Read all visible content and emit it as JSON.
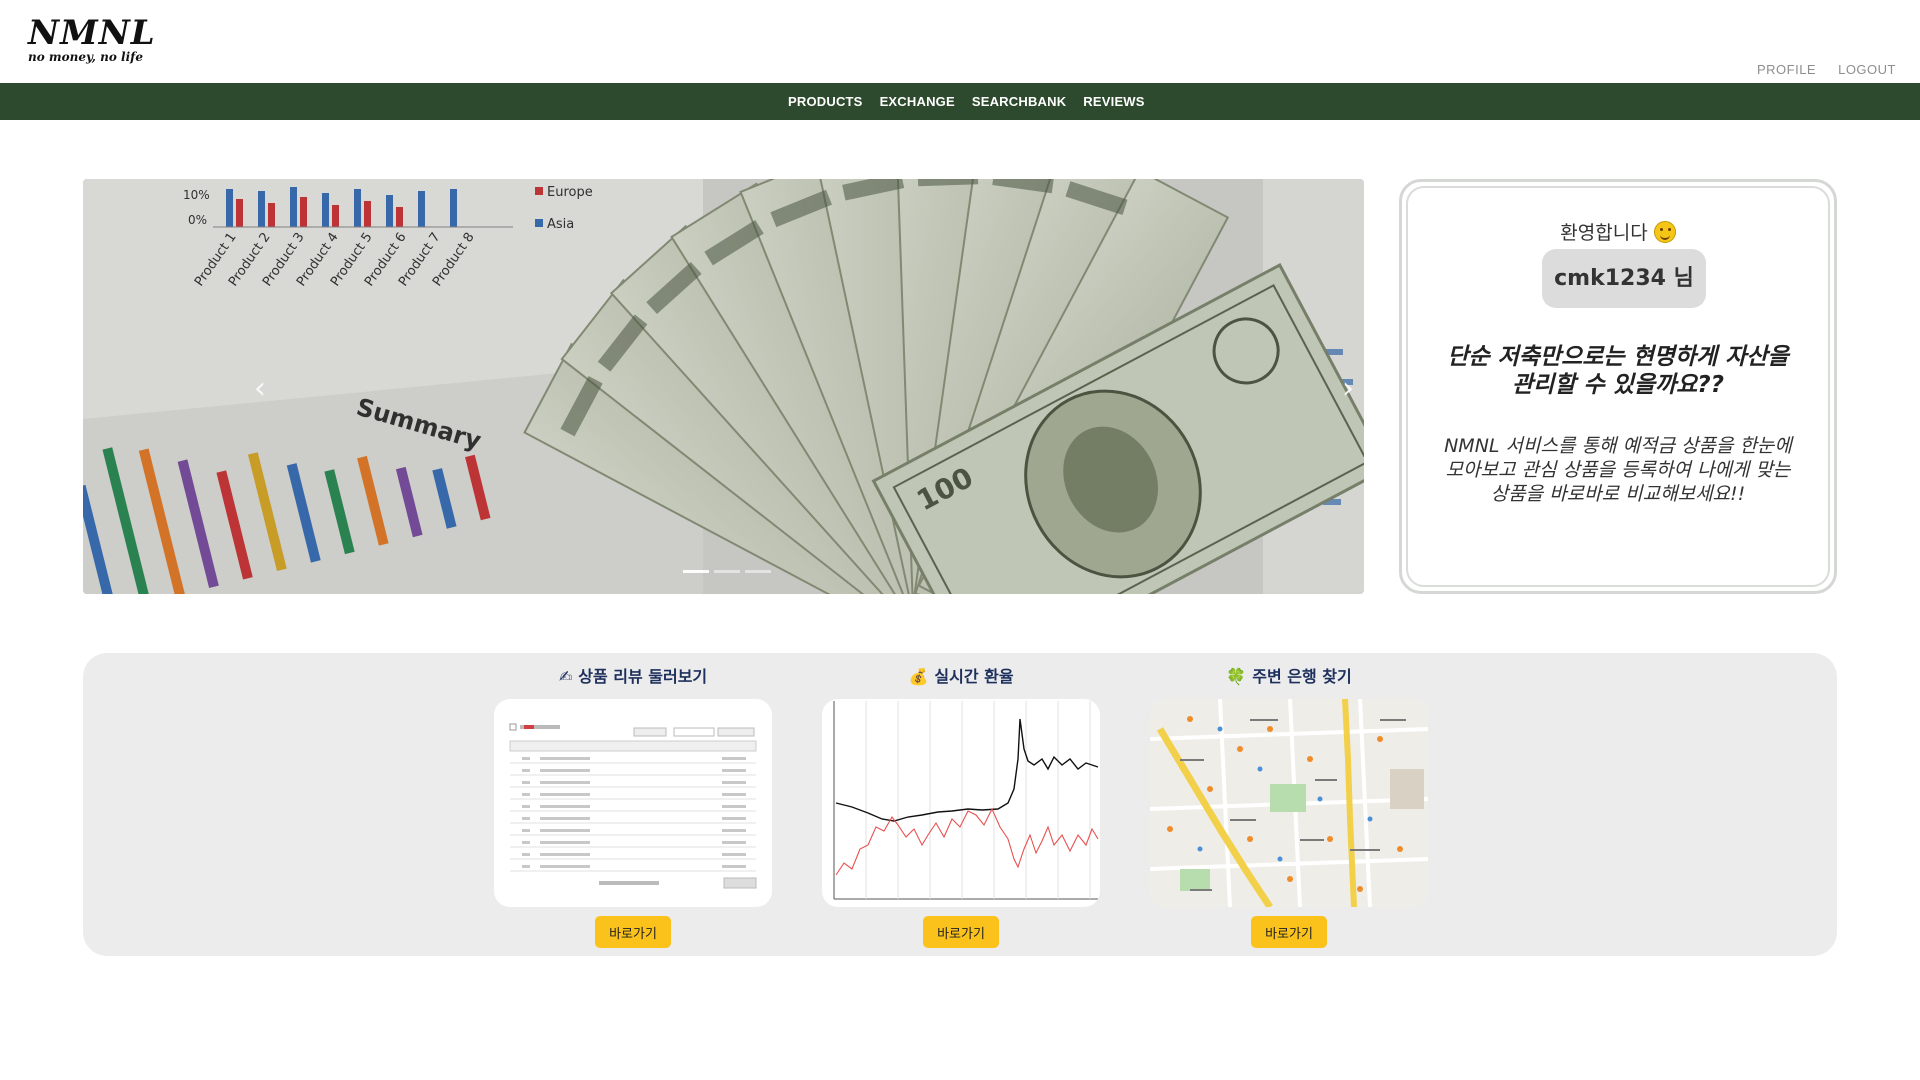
{
  "header": {
    "logo_title": "NMNL",
    "logo_subtitle": "no money, no life",
    "links": [
      "PROFILE",
      "LOGOUT"
    ]
  },
  "nav": {
    "items": [
      "PRODUCTS",
      "EXCHANGE",
      "SEARCHBANK",
      "REVIEWS"
    ],
    "background": "#2e4a2e"
  },
  "carousel": {
    "prev_icon": "chevron-left-icon",
    "next_icon": "chevron-right-icon",
    "prev_glyph": "‹",
    "next_glyph": "›",
    "slide_count": 3,
    "active_slide": 1,
    "image_text": {
      "legend": [
        "Europe",
        "Asia"
      ],
      "products": [
        "Product 1",
        "Product 2",
        "Product 3",
        "Product 4",
        "Product 5",
        "Product 6",
        "Product 7",
        "Product 8"
      ],
      "percent_labels": [
        "10%",
        "0%"
      ],
      "summary": "Summary",
      "bill_value": "100"
    }
  },
  "welcome": {
    "greeting": "환영합니다",
    "greeting_icon": "smile-emoji-icon",
    "username": "cmk1234 님",
    "headline": "단순 저축만으로는 현명하게 자산을 관리할 수 있을까요??",
    "description": "NMNL 서비스를 통해 예적금 상품을 한눈에 모아보고 관심 상품을 등록하여 나에게 맞는 상품을 바로바로 비교해보세요!!"
  },
  "features": [
    {
      "title": "상품 리뷰 둘러보기",
      "icon": "writing-hand-icon",
      "glyph": "✍",
      "button": "바로가기"
    },
    {
      "title": "실시간 환율",
      "icon": "money-bag-icon",
      "glyph": "💰",
      "button": "바로가기"
    },
    {
      "title": "주변 은행 찾기",
      "icon": "clover-icon",
      "glyph": "🍀",
      "button": "바로가기"
    }
  ],
  "colors": {
    "accent_button": "#fbc21b",
    "panel_bg": "#ececec",
    "title_text": "#1d2f5c"
  }
}
